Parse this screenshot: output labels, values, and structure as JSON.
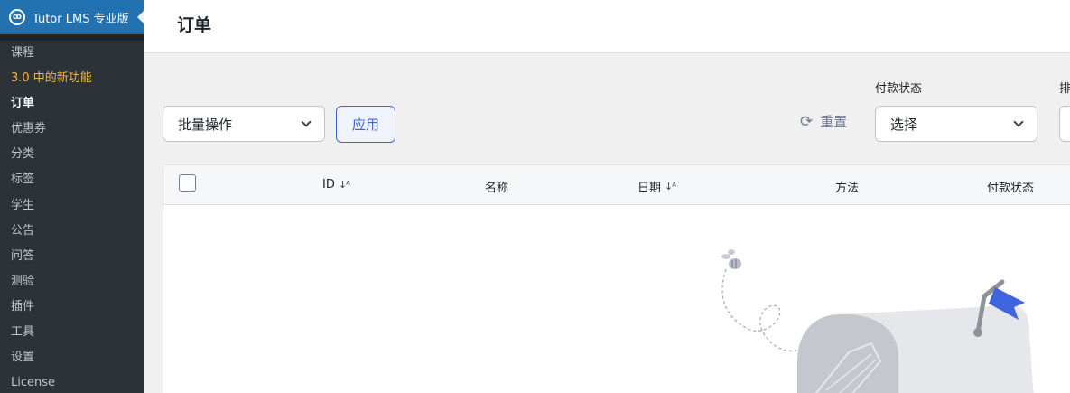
{
  "sidebar": {
    "brand": "Tutor LMS 专业版",
    "logo_icon": "owl-logo-icon",
    "items": [
      {
        "label": "课程",
        "state": "normal"
      },
      {
        "label": "3.0 中的新功能",
        "state": "highlight"
      },
      {
        "label": "订单",
        "state": "current"
      },
      {
        "label": "优惠券",
        "state": "normal"
      },
      {
        "label": "分类",
        "state": "normal"
      },
      {
        "label": "标签",
        "state": "normal"
      },
      {
        "label": "学生",
        "state": "normal"
      },
      {
        "label": "公告",
        "state": "normal"
      },
      {
        "label": "问答",
        "state": "normal"
      },
      {
        "label": "测验",
        "state": "normal"
      },
      {
        "label": "插件",
        "state": "normal"
      },
      {
        "label": "工具",
        "state": "normal"
      },
      {
        "label": "设置",
        "state": "normal"
      },
      {
        "label": "License",
        "state": "normal"
      }
    ]
  },
  "header": {
    "title": "订单"
  },
  "filters": {
    "bulk_action": "批量操作",
    "apply_label": "应用",
    "reset_label": "重置",
    "payment_status_label": "付款状态",
    "payment_status_value": "选择",
    "sort_label_partial": "排"
  },
  "table": {
    "columns": [
      "ID",
      "名称",
      "日期",
      "方法",
      "付款状态"
    ]
  },
  "colors": {
    "sidebar_bg": "#2c3338",
    "brand_bar": "#2271b1",
    "accent": "#3e64de",
    "highlight": "#f0b849"
  }
}
